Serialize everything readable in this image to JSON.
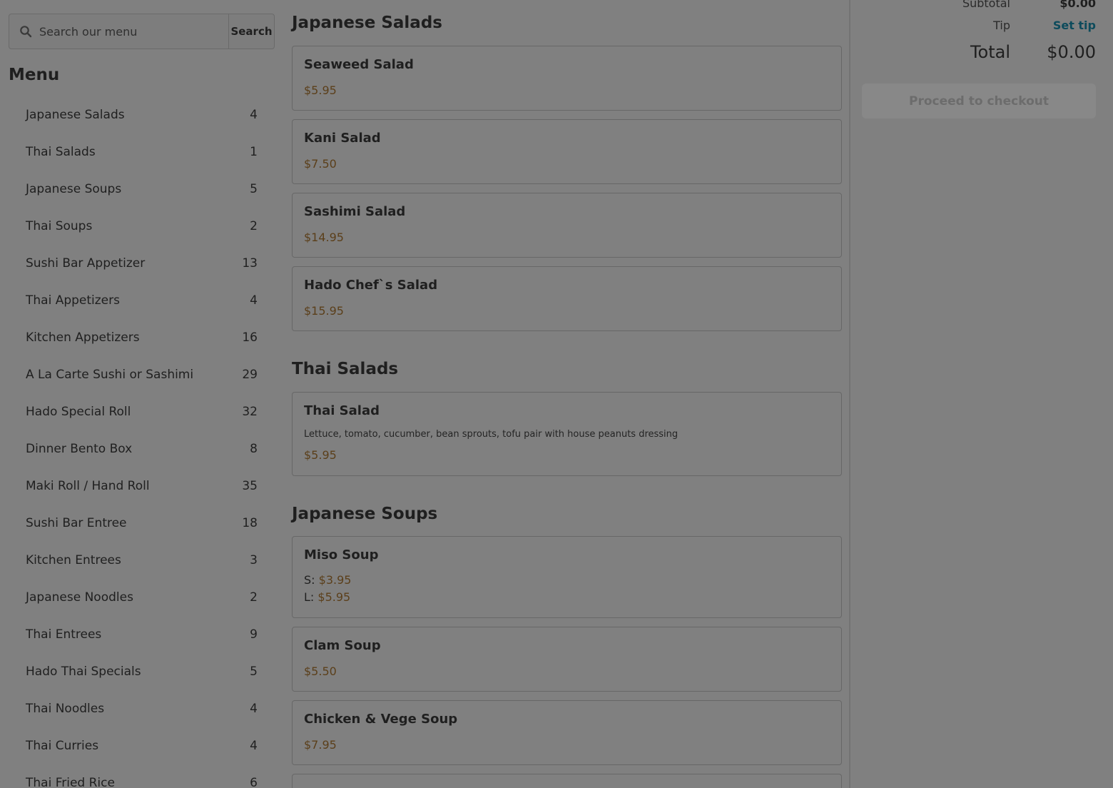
{
  "search": {
    "placeholder": "Search our menu",
    "button_label": "Search"
  },
  "sidebar": {
    "heading": "Menu",
    "items": [
      {
        "label": "Japanese Salads",
        "count": "4"
      },
      {
        "label": "Thai Salads",
        "count": "1"
      },
      {
        "label": "Japanese Soups",
        "count": "5"
      },
      {
        "label": "Thai Soups",
        "count": "2"
      },
      {
        "label": "Sushi Bar Appetizer",
        "count": "13"
      },
      {
        "label": "Thai Appetizers",
        "count": "4"
      },
      {
        "label": "Kitchen Appetizers",
        "count": "16"
      },
      {
        "label": "A La Carte Sushi or Sashimi",
        "count": "29"
      },
      {
        "label": "Hado Special Roll",
        "count": "32"
      },
      {
        "label": "Dinner Bento Box",
        "count": "8"
      },
      {
        "label": "Maki Roll / Hand Roll",
        "count": "35"
      },
      {
        "label": "Sushi Bar Entree",
        "count": "18"
      },
      {
        "label": "Kitchen Entrees",
        "count": "3"
      },
      {
        "label": "Japanese Noodles",
        "count": "2"
      },
      {
        "label": "Thai Entrees",
        "count": "9"
      },
      {
        "label": "Hado Thai Specials",
        "count": "5"
      },
      {
        "label": "Thai Noodles",
        "count": "4"
      },
      {
        "label": "Thai Curries",
        "count": "4"
      },
      {
        "label": "Thai Fried Rice",
        "count": "6"
      }
    ]
  },
  "sections": {
    "japanese_salads": {
      "title": "Japanese Salads",
      "items": [
        {
          "name": "Seaweed Salad",
          "price": "$5.95"
        },
        {
          "name": "Kani Salad",
          "price": "$7.50"
        },
        {
          "name": "Sashimi Salad",
          "price": "$14.95"
        },
        {
          "name": "Hado Chef`s Salad",
          "price": "$15.95"
        }
      ]
    },
    "thai_salads": {
      "title": "Thai Salads",
      "items": [
        {
          "name": "Thai Salad",
          "description": "Lettuce, tomato, cucumber, bean sprouts, tofu pair with house peanuts dressing",
          "price": "$5.95"
        }
      ]
    },
    "japanese_soups": {
      "title": "Japanese Soups",
      "items": [
        {
          "name": "Miso Soup",
          "sizes": [
            {
              "label": "S:",
              "price": "$3.95"
            },
            {
              "label": "L:",
              "price": "$5.95"
            }
          ]
        },
        {
          "name": "Clam Soup",
          "price": "$5.50"
        },
        {
          "name": "Chicken & Vege Soup",
          "price": "$7.95"
        }
      ]
    }
  },
  "cart": {
    "subtotal_label": "Subtotal",
    "subtotal_value": "$0.00",
    "tip_label": "Tip",
    "tip_action": "Set tip",
    "total_label": "Total",
    "total_value": "$0.00",
    "checkout_label": "Proceed to checkout"
  },
  "colors": {
    "overlay_bg": "#808080",
    "price": "#5b3f1a",
    "tip_link": "#0d4b5c"
  }
}
